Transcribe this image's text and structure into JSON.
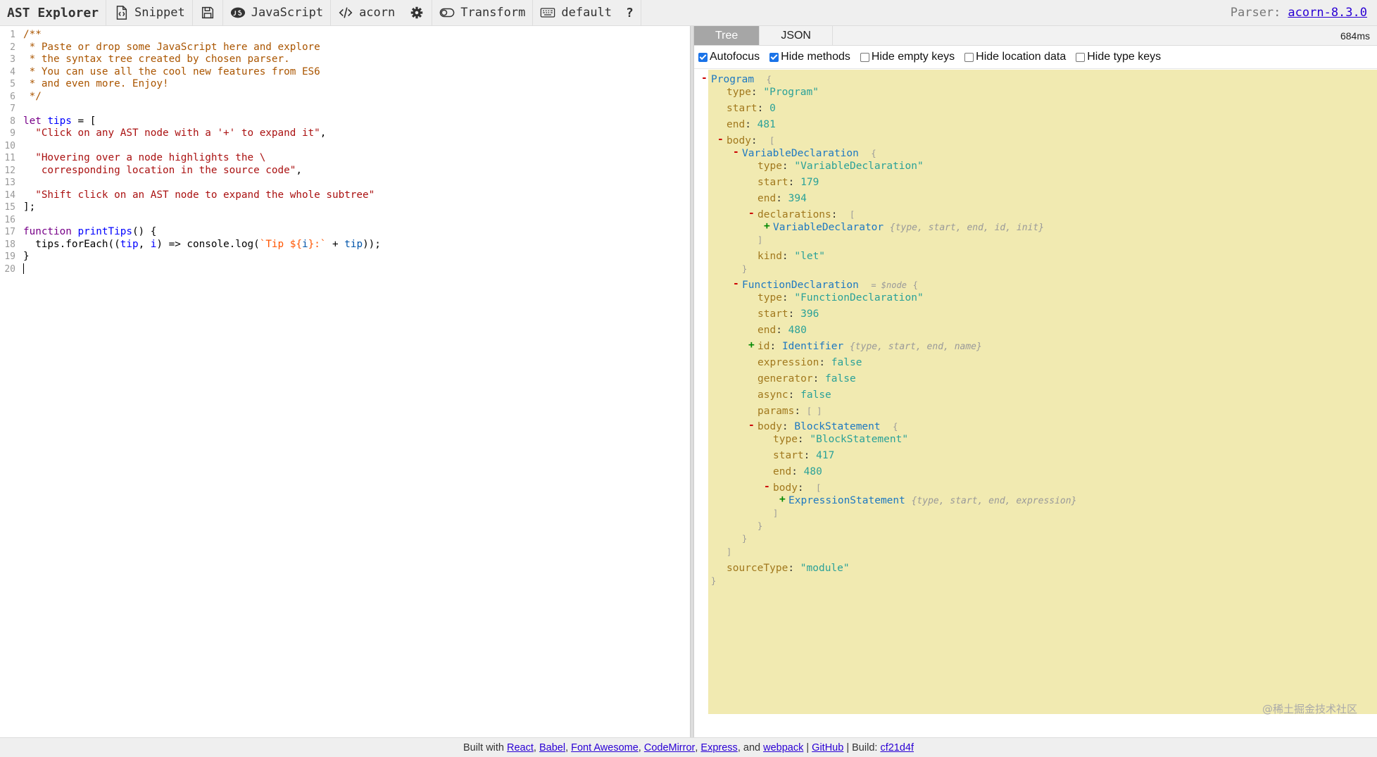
{
  "toolbar": {
    "title": "AST Explorer",
    "snippet_label": "Snippet",
    "language_label": "JavaScript",
    "parser_label": "acorn",
    "transform_label": "Transform",
    "keymap_label": "default",
    "help_label": "?",
    "parser_prefix": "Parser:",
    "parser_version": "acorn-8.3.0"
  },
  "editor": {
    "line_numbers": [
      "1",
      "2",
      "3",
      "4",
      "5",
      "6",
      "7",
      "8",
      "9",
      "10",
      "11",
      "12",
      "13",
      "14",
      "15",
      "16",
      "17",
      "18",
      "19",
      "20"
    ],
    "comment_lines": [
      "/**",
      " * Paste or drop some JavaScript here and explore",
      " * the syntax tree created by chosen parser.",
      " * You can use all the cool new features from ES6",
      " * and even more. Enjoy!",
      " */"
    ],
    "tip1": "\"Click on any AST node with a '+' to expand it\"",
    "tip2a": "\"Hovering over a node highlights the \\",
    "tip2b": "   corresponding location in the source code\"",
    "tip3": "\"Shift click on an AST node to expand the whole subtree\""
  },
  "output": {
    "tab_tree": "Tree",
    "tab_json": "JSON",
    "timing": "684ms",
    "options": [
      {
        "label": "Autofocus",
        "checked": true
      },
      {
        "label": "Hide methods",
        "checked": true
      },
      {
        "label": "Hide empty keys",
        "checked": false
      },
      {
        "label": "Hide location data",
        "checked": false
      },
      {
        "label": "Hide type keys",
        "checked": false
      }
    ],
    "tree": {
      "program": "Program",
      "program_type": "\"Program\"",
      "program_start": "0",
      "program_end": "481",
      "var_decl": "VariableDeclaration",
      "var_decl_type": "\"VariableDeclaration\"",
      "var_decl_start": "179",
      "var_decl_end": "394",
      "declarator": "VariableDeclarator",
      "declarator_hint": "{type, start, end, id, init}",
      "kind_value": "\"let\"",
      "func_decl": "FunctionDeclaration",
      "func_decl_hint": "= $node",
      "func_decl_type": "\"FunctionDeclaration\"",
      "func_decl_start": "396",
      "func_decl_end": "480",
      "identifier": "Identifier",
      "identifier_hint": "{type, start, end, name}",
      "expression_value": "false",
      "generator_value": "false",
      "async_value": "false",
      "block": "BlockStatement",
      "block_type": "\"BlockStatement\"",
      "block_start": "417",
      "block_end": "480",
      "expr_stmt": "ExpressionStatement",
      "expr_stmt_hint": "{type, start, end, expression}",
      "source_type_value": "\"module\""
    },
    "watermark": "@稀土掘金技术社区"
  },
  "footer": {
    "built_with": "Built with",
    "links": [
      "React",
      "Babel",
      "Font Awesome",
      "CodeMirror",
      "Express",
      "webpack",
      "GitHub",
      "cf21d4f"
    ],
    "and": "and",
    "build_label": "Build:"
  }
}
